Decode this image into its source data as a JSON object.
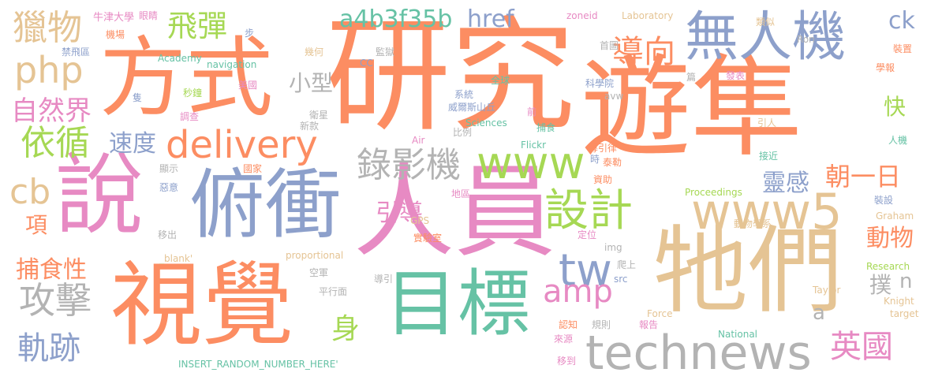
{
  "words": [
    {
      "text": "研究",
      "color": "#fc8d62"
    },
    {
      "text": "遊隼",
      "color": "#fc8d62"
    },
    {
      "text": "人員",
      "color": "#e78ac3"
    },
    {
      "text": "牠們",
      "color": "#e5c494"
    },
    {
      "text": "視覺",
      "color": "#fc8d62"
    },
    {
      "text": "方式",
      "color": "#fc8d62"
    },
    {
      "text": "目標",
      "color": "#66c2a5"
    },
    {
      "text": "說",
      "color": "#e78ac3"
    },
    {
      "text": "俯衝",
      "color": "#8da0cb"
    },
    {
      "text": "無人機",
      "color": "#8da0cb"
    },
    {
      "text": "technews",
      "color": "#b3b3b3"
    },
    {
      "text": "www5",
      "color": "#e5c494"
    },
    {
      "text": "www",
      "color": "#a6d854"
    },
    {
      "text": "delivery",
      "color": "#fc8d62"
    },
    {
      "text": "設計",
      "color": "#a6d854"
    },
    {
      "text": "tw",
      "color": "#8da0cb"
    },
    {
      "text": "amp",
      "color": "#e78ac3"
    },
    {
      "text": "攻擊",
      "color": "#b3b3b3"
    },
    {
      "text": "錄影機",
      "color": "#b3b3b3"
    },
    {
      "text": "獵物",
      "color": "#e5c494"
    },
    {
      "text": "php",
      "color": "#e5c494"
    },
    {
      "text": "英國",
      "color": "#e78ac3"
    },
    {
      "text": "軌跡",
      "color": "#8da0cb"
    },
    {
      "text": "依循",
      "color": "#a6d854"
    },
    {
      "text": "飛彈",
      "color": "#a6d854"
    },
    {
      "text": "導向",
      "color": "#fc8d62"
    },
    {
      "text": "a4b3f35b",
      "color": "#66c2a5"
    },
    {
      "text": "cb",
      "color": "#e5c494"
    },
    {
      "text": "自然界",
      "color": "#e78ac3"
    },
    {
      "text": "朝一日",
      "color": "#fc8d62"
    },
    {
      "text": "速度",
      "color": "#8da0cb"
    },
    {
      "text": "捕食性",
      "color": "#fc8d62"
    },
    {
      "text": "身",
      "color": "#a6d854"
    },
    {
      "text": "靈感",
      "color": "#8da0cb"
    },
    {
      "text": "動物",
      "color": "#fc8d62"
    },
    {
      "text": "引導",
      "color": "#e78ac3"
    },
    {
      "text": "href",
      "color": "#8da0cb"
    },
    {
      "text": "ck",
      "color": "#8da0cb"
    },
    {
      "text": "小型",
      "color": "#b3b3b3"
    },
    {
      "text": "快",
      "color": "#a6d854"
    },
    {
      "text": "項",
      "color": "#fc8d62"
    },
    {
      "text": "撲",
      "color": "#b3b3b3"
    },
    {
      "text": "n",
      "color": "#b3b3b3"
    },
    {
      "text": "a",
      "color": "#b3b3b3"
    },
    {
      "text": "牛津大學",
      "color": "#e78ac3"
    },
    {
      "text": "眼睛",
      "color": "#e78ac3"
    },
    {
      "text": "zoneid",
      "color": "#e78ac3"
    },
    {
      "text": "Laboratory",
      "color": "#e5c494"
    },
    {
      "text": "類似",
      "color": "#e5c494"
    },
    {
      "text": "機場",
      "color": "#fc8d62"
    },
    {
      "text": "步",
      "color": "#8da0cb"
    },
    {
      "text": "禁飛區",
      "color": "#8da0cb"
    },
    {
      "text": "幾何",
      "color": "#e5c494"
    },
    {
      "text": "監獄",
      "color": "#b3b3b3"
    },
    {
      "text": "首圖",
      "color": "#b3b3b3"
    },
    {
      "text": "Ron",
      "color": "#b3b3b3"
    },
    {
      "text": "裝置",
      "color": "#fc8d62"
    },
    {
      "text": "Academy",
      "color": "#66c2a5"
    },
    {
      "text": "navigation",
      "color": "#66c2a5"
    },
    {
      "text": "CC",
      "color": "#8da0cb"
    },
    {
      "text": "學報",
      "color": "#fc8d62"
    },
    {
      "text": "全球",
      "color": "#66c2a5"
    },
    {
      "text": "篇",
      "color": "#b3b3b3"
    },
    {
      "text": "發表",
      "color": "#e78ac3"
    },
    {
      "text": "美國",
      "color": "#e78ac3"
    },
    {
      "text": "科學院",
      "color": "#8da0cb"
    },
    {
      "text": "隻",
      "color": "#8da0cb"
    },
    {
      "text": "秒鐘",
      "color": "#a6d854"
    },
    {
      "text": "系統",
      "color": "#8da0cb"
    },
    {
      "text": "avw",
      "color": "#b3b3b3"
    },
    {
      "text": "威爾斯山丘",
      "color": "#8da0cb"
    },
    {
      "text": "前",
      "color": "#e78ac3"
    },
    {
      "text": "調查",
      "color": "#e78ac3"
    },
    {
      "text": "衛星",
      "color": "#b3b3b3"
    },
    {
      "text": "新款",
      "color": "#b3b3b3"
    },
    {
      "text": "Sciences",
      "color": "#66c2a5"
    },
    {
      "text": "捕食",
      "color": "#66c2a5"
    },
    {
      "text": "引人",
      "color": "#e5c494"
    },
    {
      "text": "比例",
      "color": "#b3b3b3"
    },
    {
      "text": "Air",
      "color": "#e78ac3"
    },
    {
      "text": "Flickr",
      "color": "#66c2a5"
    },
    {
      "text": "導引律",
      "color": "#fc8d62"
    },
    {
      "text": "人機",
      "color": "#66c2a5"
    },
    {
      "text": "顯示",
      "color": "#b3b3b3"
    },
    {
      "text": "時",
      "color": "#8da0cb"
    },
    {
      "text": "泰勒",
      "color": "#fc8d62"
    },
    {
      "text": "接近",
      "color": "#66c2a5"
    },
    {
      "text": "國家",
      "color": "#fc8d62"
    },
    {
      "text": "資助",
      "color": "#fc8d62"
    },
    {
      "text": "惡意",
      "color": "#8da0cb"
    },
    {
      "text": "地區",
      "color": "#e78ac3"
    },
    {
      "text": "Proceedings",
      "color": "#a6d854"
    },
    {
      "text": "裝設",
      "color": "#8da0cb"
    },
    {
      "text": "Graham",
      "color": "#e5c494"
    },
    {
      "text": "GPS",
      "color": "#e5c494"
    },
    {
      "text": "移出",
      "color": "#b3b3b3"
    },
    {
      "text": "動物學系",
      "color": "#e5c494"
    },
    {
      "text": "_blank'",
      "color": "#e5c494"
    },
    {
      "text": "proportional",
      "color": "#e5c494"
    },
    {
      "text": "實驗室",
      "color": "#fc8d62"
    },
    {
      "text": "定位",
      "color": "#e78ac3"
    },
    {
      "text": "img",
      "color": "#b3b3b3"
    },
    {
      "text": "爬上",
      "color": "#b3b3b3"
    },
    {
      "text": "Research",
      "color": "#a6d854"
    },
    {
      "text": "空軍",
      "color": "#b3b3b3"
    },
    {
      "text": "導引",
      "color": "#b3b3b3"
    },
    {
      "text": "src",
      "color": "#8da0cb"
    },
    {
      "text": "平行面",
      "color": "#b3b3b3"
    },
    {
      "text": "Taylor",
      "color": "#e5c494"
    },
    {
      "text": "Knight",
      "color": "#e5c494"
    },
    {
      "text": "Force",
      "color": "#e5c494"
    },
    {
      "text": "target",
      "color": "#e5c494"
    },
    {
      "text": "認知",
      "color": "#fc8d62"
    },
    {
      "text": "規則",
      "color": "#b3b3b3"
    },
    {
      "text": "報告",
      "color": "#e78ac3"
    },
    {
      "text": "來源",
      "color": "#e78ac3"
    },
    {
      "text": "National",
      "color": "#66c2a5"
    },
    {
      "text": "INSERT_RANDOM_NUMBER_HERE'",
      "color": "#66c2a5"
    },
    {
      "text": "移到",
      "color": "#e78ac3"
    }
  ]
}
